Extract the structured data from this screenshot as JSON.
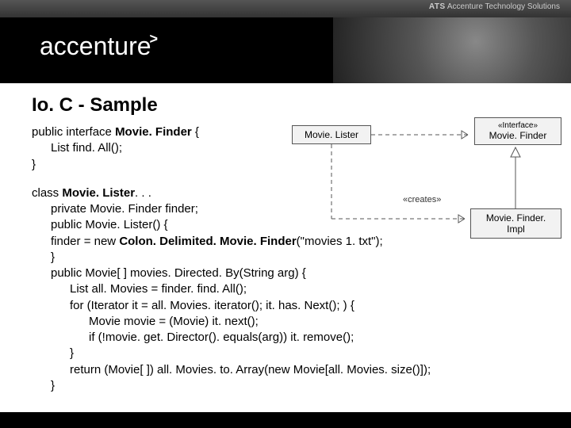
{
  "header": {
    "ats_strong": "ATS",
    "ats_rest": " Accenture Technology Solutions",
    "logo_text": "accenture",
    "logo_arrow": ">"
  },
  "title": "Io. C - Sample",
  "code1": {
    "l1a": "public interface ",
    "l1b": "Movie. Finder ",
    "l1c": "{",
    "l2": "List find. All();",
    "l3": "}"
  },
  "code2": {
    "l1a": "class ",
    "l1b": "Movie. Lister",
    "l1c": ". . .",
    "l2": "private Movie. Finder finder;",
    "l3": "public Movie. Lister() {",
    "l4a": "finder = new ",
    "l4b": "Colon. Delimited. Movie. Finder",
    "l4c": "(\"movies 1. txt\");",
    "l5": "}",
    "l6": "public Movie[ ] movies. Directed. By(String arg) {",
    "l7": "List all. Movies = finder. find. All();",
    "l8": "for (Iterator it = all. Movies. iterator(); it. has. Next(); ) {",
    "l9": "Movie movie = (Movie) it. next();",
    "l10": "if (!movie. get. Director(). equals(arg)) it. remove();",
    "l11": "}",
    "l12": "return (Movie[ ]) all. Movies. to. Array(new Movie[all. Movies. size()]);",
    "l13": "}"
  },
  "uml": {
    "lister": "Movie. Lister",
    "finder_stereo": "«Interface»",
    "finder": "Movie. Finder",
    "impl": "Movie. Finder. Impl",
    "creates": "«creates»"
  }
}
